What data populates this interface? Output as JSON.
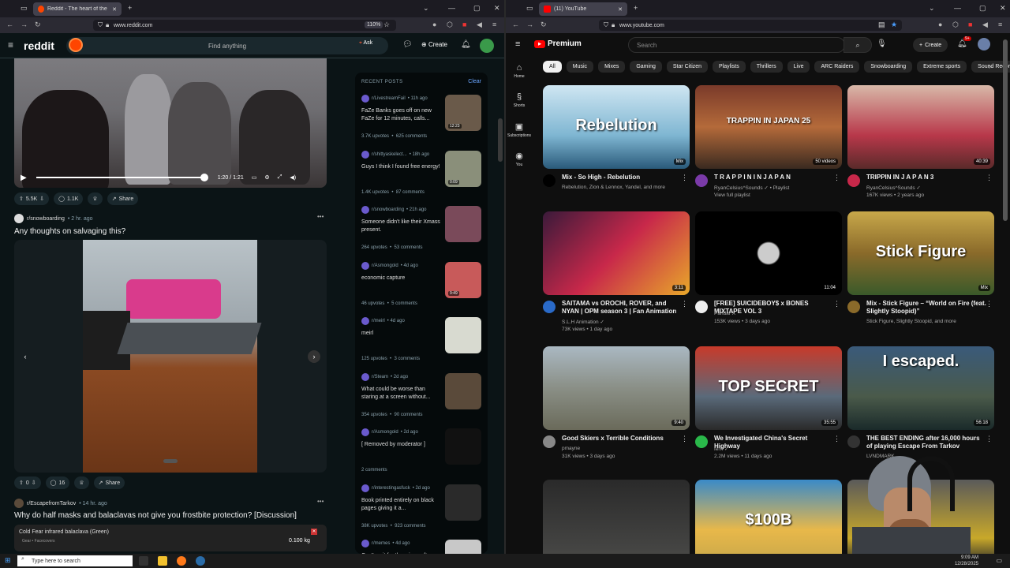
{
  "left_browser": {
    "tab_title": "Reddit - The heart of the intern",
    "url": "www.reddit.com",
    "zoom": "110%"
  },
  "right_browser": {
    "tab_title": "(11) YouTube",
    "url": "www.youtube.com"
  },
  "reddit": {
    "logo": "reddit",
    "search_placeholder": "Find anything",
    "ask_label": "Ask",
    "create_label": "Create",
    "video": {
      "time": "1:20 / 1:21",
      "progress_fraction": 0.98
    },
    "post1_actions": {
      "votes": "5.5K",
      "comments": "1.1K",
      "share": "Share"
    },
    "post2": {
      "subreddit": "r/snowboarding",
      "age": "• 2 hr. ago",
      "title": "Any thoughts on salvaging this?",
      "votes": "0",
      "comments": "16",
      "share": "Share"
    },
    "post3": {
      "subreddit": "r/EscapefromTarkov",
      "age": "• 14 hr. ago",
      "title": "Why do half masks and balaclavas not give you frostbite protection? [Discussion]",
      "embed_item": "Cold Fear infrared balaclava (Green)",
      "embed_category": "Gear • Facecovers",
      "embed_weight": "0.100 kg"
    },
    "recent": {
      "heading": "RECENT POSTS",
      "clear": "Clear",
      "posts": [
        {
          "sub": "r/LivestreamFail",
          "age": "• 11h ago",
          "title": "FaZe Banks goes off on new FaZe for 12 minutes, calls...",
          "upvotes": "3.7K upvotes",
          "comments": "625 comments",
          "duration": "12:23"
        },
        {
          "sub": "r/shittyaskelect...",
          "age": "• 18h ago",
          "title": "Guys I think I found free energy!",
          "upvotes": "1.4K upvotes",
          "comments": "87 comments",
          "duration": "0:09"
        },
        {
          "sub": "r/snowboarding",
          "age": "• 21h ago",
          "title": "Someone didn't like their Xmass present.",
          "upvotes": "264 upvotes",
          "comments": "53 comments",
          "duration": ""
        },
        {
          "sub": "r/Asmongold",
          "age": "• 4d ago",
          "title": "economic capture",
          "upvotes": "46 upvotes",
          "comments": "5 comments",
          "duration": "9:49"
        },
        {
          "sub": "r/meirl",
          "age": "• 4d ago",
          "title": "meirl",
          "upvotes": "125 upvotes",
          "comments": "3 comments",
          "duration": ""
        },
        {
          "sub": "r/Steam",
          "age": "• 2d ago",
          "title": "What could be worse than staring at a screen without...",
          "upvotes": "354 upvotes",
          "comments": "90 comments",
          "duration": ""
        },
        {
          "sub": "r/Asmongold",
          "age": "• 2d ago",
          "title": "[ Removed by moderator ]",
          "upvotes": "2 comments",
          "comments": "",
          "duration": ""
        },
        {
          "sub": "r/interestingasfuck",
          "age": "• 2d ago",
          "title": "Book printed entirely on black pages giving it a...",
          "upvotes": "38K upvotes",
          "comments": "923 comments",
          "duration": ""
        },
        {
          "sub": "r/memes",
          "age": "• 4d ago",
          "title": "Can't wait for the minecraft",
          "upvotes": "",
          "comments": "",
          "duration": ""
        }
      ]
    }
  },
  "youtube": {
    "logo": "Premium",
    "search_placeholder": "Search",
    "create_label": "Create",
    "notif_count": "9+",
    "sidebar": [
      {
        "label": "Home",
        "icon": "home-icon"
      },
      {
        "label": "Shorts",
        "icon": "shorts-icon"
      },
      {
        "label": "Subscriptions",
        "icon": "subscriptions-icon"
      },
      {
        "label": "You",
        "icon": "you-icon"
      }
    ],
    "chips": [
      "All",
      "Music",
      "Mixes",
      "Gaming",
      "Star Citizen",
      "Playlists",
      "Thrillers",
      "Live",
      "ARC Raiders",
      "Snowboarding",
      "Extreme sports",
      "Sound Recording"
    ],
    "videos": [
      {
        "title": "Mix - So High - Rebelution",
        "channel": "Rebelution, Zion & Lennox, Yandel, and more",
        "meta": "",
        "badge": "Mix",
        "thumb_text": "Rebelution"
      },
      {
        "title": "T R A P P I N  I N  J A P A N",
        "channel": "RyanCelsius^Sounds ✓ • Playlist",
        "meta": "View full playlist",
        "badge": "50 videos",
        "thumb_text": "TRAPPIN IN JAPAN 25"
      },
      {
        "title": "TRIPPIN IN J A P A N 3",
        "channel": "RyanCelsius^Sounds ✓",
        "meta": "167K views • 2 years ago",
        "badge": "40:39",
        "thumb_text": ""
      },
      {
        "title": "SAITAMA vs OROCHI, ROVER, and NYAN | OPM season 3 | Fan Animation",
        "channel": "S.L.H Animation ✓",
        "meta": "73K views • 1 day ago",
        "badge": "3:11",
        "thumb_text": ""
      },
      {
        "title": "[FREE] $UICIDEBOY$ x BONES MIXTAPE VOL 3",
        "channel": "PandaFX",
        "meta": "153K views • 3 days ago",
        "badge": "11:04",
        "thumb_text": ""
      },
      {
        "title": "Mix - Stick Figure – “World on Fire (feat. Slightly Stoopid)”",
        "channel": "Stick Figure, Slightly Stoopid, and more",
        "meta": "",
        "badge": "Mix",
        "thumb_text": "Stick Figure"
      },
      {
        "title": "Good Skiers x Terrible Conditions",
        "channel": "pmayne",
        "meta": "31K views • 3 days ago",
        "badge": "9:40",
        "thumb_text": ""
      },
      {
        "title": "We Investigated China's Secret Highway",
        "channel": "fern ✓",
        "meta": "2.2M views • 11 days ago",
        "badge": "35:55",
        "thumb_text": "TOP SECRET"
      },
      {
        "title": "THE BEST ENDING after 16,000 hours of playing Escape From Tarkov",
        "channel": "LVNDMARK",
        "meta": "",
        "badge": "56:18",
        "thumb_text": "I escaped."
      },
      {
        "title": "",
        "channel": "",
        "meta": "",
        "badge": "",
        "thumb_text": ""
      },
      {
        "title": "",
        "channel": "",
        "meta": "",
        "badge": "",
        "thumb_text": "$100B"
      },
      {
        "title": "",
        "channel": "",
        "meta": "",
        "badge": "",
        "thumb_text": ""
      }
    ]
  },
  "taskbar": {
    "search_placeholder": "Type here to search",
    "time": "9:09 AM",
    "date": "12/28/2025"
  },
  "colors": {
    "reddit_orange": "#ff4500",
    "youtube_red": "#ff0000",
    "reddit_bg": "#0b1416",
    "youtube_bg": "#0f0f0f"
  }
}
